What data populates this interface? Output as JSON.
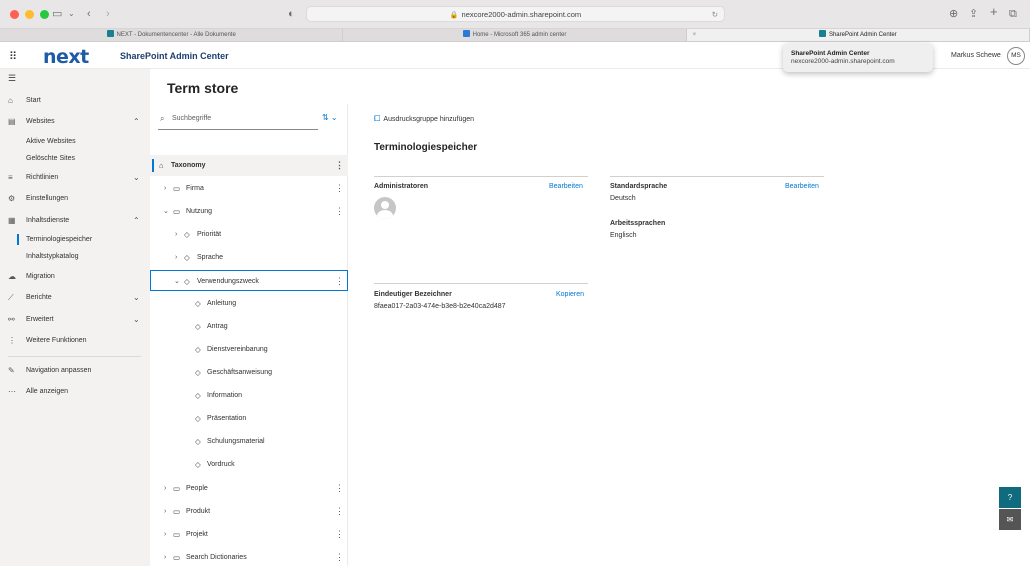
{
  "browser": {
    "url": "nexcore2000-admin.sharepoint.com",
    "tabs": [
      {
        "label": "NEXT - Dokumentencenter - Alle Dokumente"
      },
      {
        "label": "Home - Microsoft 365 admin center"
      },
      {
        "label": "SharePoint Admin Center"
      }
    ]
  },
  "header": {
    "logo": "next",
    "app_title": "SharePoint Admin Center",
    "user_name": "Markus Schewe",
    "user_initials": "MS",
    "popup_title": "SharePoint Admin Center",
    "popup_subtitle": "nexcore2000-admin.sharepoint.com"
  },
  "nav": {
    "start": "Start",
    "websites": "Websites",
    "aktive": "Aktive Websites",
    "geloeschte": "Gelöschte Sites",
    "richtlinien": "Richtlinien",
    "einstellungen": "Einstellungen",
    "inhaltsdienste": "Inhaltsdienste",
    "terminologie": "Terminologiespeicher",
    "inhaltstyp": "Inhaltstypkatalog",
    "migration": "Migration",
    "berichte": "Berichte",
    "erweitert": "Erweitert",
    "weitere": "Weitere Funktionen",
    "anpassen": "Navigation anpassen",
    "alle": "Alle anzeigen"
  },
  "main": {
    "page_title": "Term store",
    "search_placeholder": "Suchbegriffe"
  },
  "tree": {
    "root": "Taxonomy",
    "firma": "Firma",
    "nutzung": "Nutzung",
    "prioritaet": "Priorität",
    "sprache": "Sprache",
    "verwendungszweck": "Verwendungszweck",
    "anleitung": "Anleitung",
    "antrag": "Antrag",
    "dienstvereinbarung": "Dienstvereinbarung",
    "geschaeftsanweisung": "Geschäftsanweisung",
    "information": "Information",
    "praesentation": "Präsentation",
    "schulungsmaterial": "Schulungsmaterial",
    "vordruck": "Vordruck",
    "people": "People",
    "produkt": "Produkt",
    "projekt": "Projekt",
    "search_dictionaries": "Search Dictionaries"
  },
  "details": {
    "add_group": "Ausdrucksgruppe hinzufügen",
    "section_title": "Terminologiespeicher",
    "admins_label": "Administratoren",
    "edit1": "Bearbeiten",
    "default_lang_label": "Standardsprache",
    "default_lang_value": "Deutsch",
    "edit2": "Bearbeiten",
    "work_lang_label": "Arbeitssprachen",
    "work_lang_value": "Englisch",
    "unique_id_label": "Eindeutiger Bezeichner",
    "copy": "Kopieren",
    "unique_id_value": "8faea017-2a03-474e-b3e8-b2e40ca2d487"
  },
  "colors": {
    "accent": "#0078d4",
    "brand_dark": "#1e5aa8"
  }
}
